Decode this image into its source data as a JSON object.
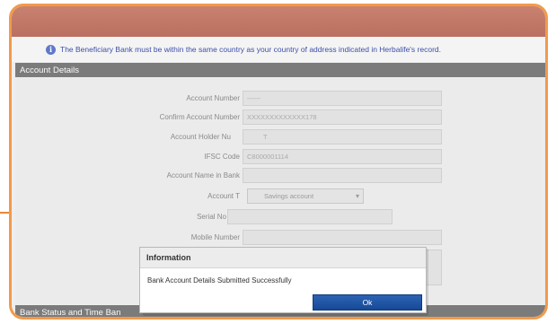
{
  "notice": {
    "text": "The Beneficiary Bank must be within the same country as your country of address indicated in Herbalife's record."
  },
  "sections": {
    "account_details": "Account Details",
    "bank_status": "Bank Status and Time Ban"
  },
  "form": {
    "account_number": {
      "label": "Account Number",
      "value": "------"
    },
    "confirm_account_number": {
      "label": "Confirm Account Number",
      "value": "XXXXXXXXXXXXX178"
    },
    "account_holder": {
      "label": "Account Holder Nu",
      "value": "T"
    },
    "ifsc_code": {
      "label": "IFSC Code",
      "value": "C8000001114"
    },
    "account_name": {
      "label": "Account Name in Bank",
      "value": ""
    },
    "account_type": {
      "label": "Account T",
      "value": "Savings account"
    },
    "serial_no": {
      "label": "Serial No",
      "value": ""
    },
    "mobile_number": {
      "label": "Mobile Number",
      "value": ""
    }
  },
  "dialog": {
    "title": "Information",
    "message": "Bank Account Details Submitted Successfully",
    "ok_label": "Ok"
  },
  "colors": {
    "frame_border": "#f29a4a",
    "top_bar": "#c07868",
    "section_header": "#7b7b7b",
    "ok_button": "#1f56a6"
  }
}
